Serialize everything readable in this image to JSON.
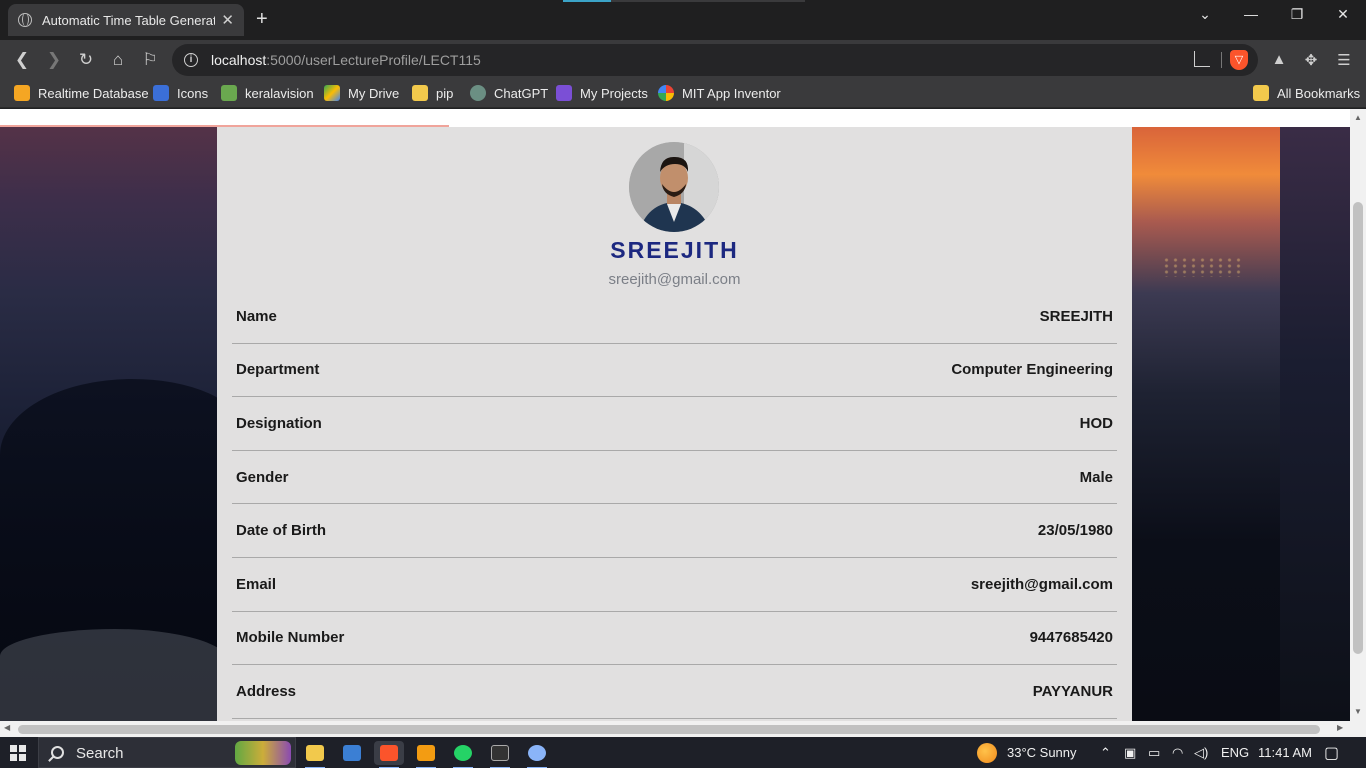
{
  "browser": {
    "tab_title": "Automatic Time Table Generator",
    "tab_close": "✕",
    "new_tab": "+",
    "url_host": "localhost",
    "url_path": ":5000/userLectureProfile/LECT115"
  },
  "bookmarks": [
    {
      "label": "Realtime Database",
      "icon": "firebase-icon",
      "color": "#f5a623"
    },
    {
      "label": "Icons",
      "icon": "icons-site-icon",
      "color": "#3b6fd8"
    },
    {
      "label": "keralavision",
      "icon": "keralavision-icon",
      "color": "#6aa84f"
    },
    {
      "label": "My Drive",
      "icon": "google-drive-icon",
      "color": "#34a853"
    },
    {
      "label": "pip",
      "icon": "folder-icon",
      "color": "#f2c94c"
    },
    {
      "label": "ChatGPT",
      "icon": "chatgpt-icon",
      "color": "#6b8f83"
    },
    {
      "label": "My Projects",
      "icon": "bolt-icon",
      "color": "#7b4fd6"
    },
    {
      "label": "MIT App Inventor",
      "icon": "google-icon",
      "color": "#ffffff"
    }
  ],
  "all_bookmarks": "All Bookmarks",
  "profile": {
    "name": "SREEJITH",
    "email": "sreejith@gmail.com",
    "fields": [
      {
        "label": "Name",
        "value": "SREEJITH"
      },
      {
        "label": "Department",
        "value": "Computer Engineering"
      },
      {
        "label": "Designation",
        "value": "HOD"
      },
      {
        "label": "Gender",
        "value": "Male"
      },
      {
        "label": "Date of Birth",
        "value": "23/05/1980"
      },
      {
        "label": "Email",
        "value": "sreejith@gmail.com"
      },
      {
        "label": "Mobile Number",
        "value": "9447685420"
      },
      {
        "label": "Address",
        "value": "PAYYANUR"
      }
    ]
  },
  "taskbar": {
    "search_label": "Search",
    "weather": "33°C  Sunny",
    "language": "ENG",
    "time": "11:41 AM"
  },
  "colors": {
    "accent_name": "#1c2880",
    "card_bg": "#e1e0e0",
    "brave": "#fb542b"
  }
}
